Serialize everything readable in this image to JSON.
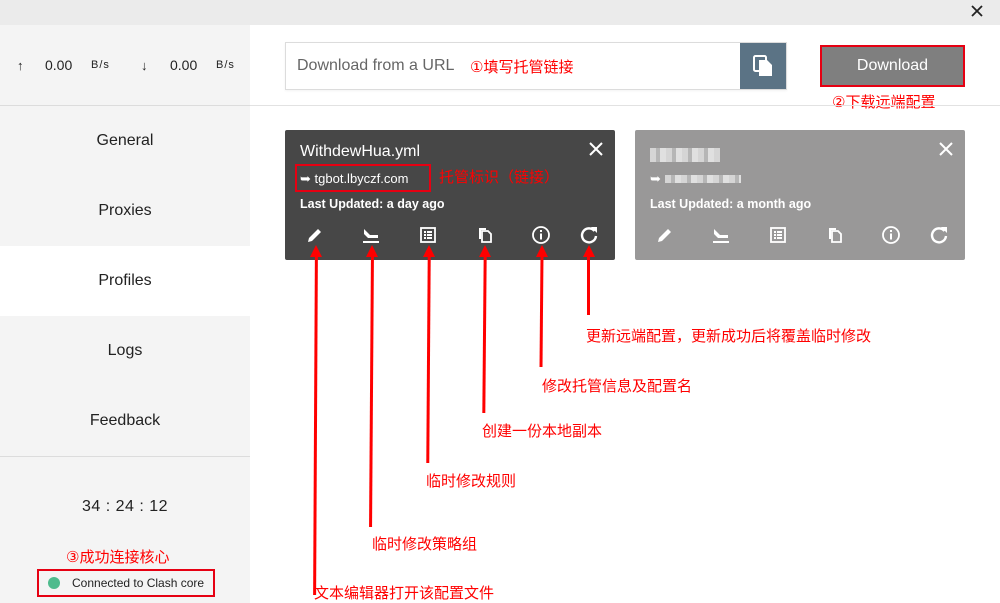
{
  "titlebar": {
    "close_icon": "close-icon"
  },
  "traffic": {
    "upload_arrow": "↑",
    "upload_value": "0.00",
    "upload_unit": "B/s",
    "download_arrow": "↓",
    "download_value": "0.00",
    "download_unit": "B/s"
  },
  "sidebar": {
    "items": [
      {
        "label": "General",
        "active": false
      },
      {
        "label": "Proxies",
        "active": false
      },
      {
        "label": "Profiles",
        "active": true
      },
      {
        "label": "Logs",
        "active": false
      },
      {
        "label": "Feedback",
        "active": false
      }
    ],
    "uptime": "34 : 24 : 12",
    "status": {
      "text": "Connected to Clash core",
      "color": "#4fbb8d"
    }
  },
  "toolbar": {
    "url_placeholder": "Download from a URL",
    "url_value": "",
    "paste_icon": "paste-icon",
    "download_label": "Download"
  },
  "profiles": [
    {
      "name": "WithdewHua.yml",
      "url": "tgbot.lbyczf.com",
      "url_prefix": "➥",
      "updated": "Last Updated: a day ago",
      "active": true
    },
    {
      "name": "",
      "url": "",
      "url_prefix": "➥",
      "updated": "Last Updated: a month ago",
      "active": false,
      "redacted": true
    }
  ],
  "card_actions": [
    "edit-icon",
    "proxy-groups-icon",
    "rules-icon",
    "duplicate-icon",
    "info-icon",
    "refresh-icon"
  ],
  "annotations": {
    "fill_url": "①填写托管链接",
    "download": "②下载远端配置",
    "connected": "③成功连接核心",
    "hosted_id": "托管标识（链接）",
    "refresh": "更新远端配置，更新成功后将覆盖临时修改",
    "info": "修改托管信息及配置名",
    "duplicate": "创建一份本地副本",
    "rules": "临时修改规则",
    "proxy_groups": "临时修改策略组",
    "edit": "文本编辑器打开该配置文件"
  },
  "colors": {
    "accent_red": "#e60012",
    "card_active_bg": "#474747",
    "card_inactive_bg": "#999898",
    "paste_btn_bg": "#5b7385",
    "download_btn_bg": "#7f7f7f",
    "status_dot": "#4fbb8d"
  }
}
